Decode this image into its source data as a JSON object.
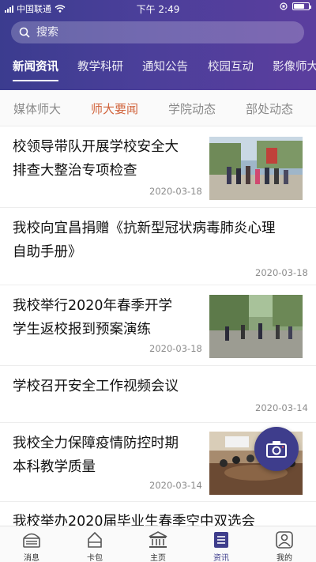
{
  "status_bar": {
    "carrier": "中国联通",
    "time": "下午 2:49",
    "battery_level": 0.72
  },
  "search": {
    "placeholder": "搜索"
  },
  "top_tabs": [
    {
      "label": "新闻资讯",
      "active": true
    },
    {
      "label": "教学科研",
      "active": false
    },
    {
      "label": "通知公告",
      "active": false
    },
    {
      "label": "校园互动",
      "active": false
    },
    {
      "label": "影像师大",
      "active": false
    }
  ],
  "sub_tabs": [
    {
      "label": "媒体师大",
      "active": false
    },
    {
      "label": "师大要闻",
      "active": true
    },
    {
      "label": "学院动态",
      "active": false
    },
    {
      "label": "部处动态",
      "active": false
    }
  ],
  "news": [
    {
      "title_lines": [
        "校领导带队开展学校安全大",
        "排查大整治专项检查"
      ],
      "date": "2020-03-18",
      "has_image": true
    },
    {
      "title_lines": [
        "我校向宜昌捐赠《抗新型冠状病毒肺炎心理",
        "自助手册》"
      ],
      "date": "2020-03-18",
      "has_image": false
    },
    {
      "title_lines": [
        "我校举行2020年春季开学",
        "学生返校报到预案演练"
      ],
      "date": "2020-03-18",
      "has_image": true
    },
    {
      "title_lines": [
        "学校召开安全工作视频会议"
      ],
      "date": "2020-03-14",
      "has_image": false
    },
    {
      "title_lines": [
        "我校全力保障疫情防控时期",
        "本科教学质量"
      ],
      "date": "2020-03-14",
      "has_image": true
    },
    {
      "title_lines": [
        "我校举办2020届毕业生春季空中双选会"
      ],
      "date": "",
      "has_image": false
    }
  ],
  "bottom_nav": [
    {
      "label": "消息",
      "icon": "message-icon",
      "active": false
    },
    {
      "label": "卡包",
      "icon": "card-wallet-icon",
      "active": false
    },
    {
      "label": "主页",
      "icon": "home-building-icon",
      "active": false
    },
    {
      "label": "资讯",
      "icon": "news-icon",
      "active": true
    },
    {
      "label": "我的",
      "icon": "profile-icon",
      "active": false
    }
  ],
  "colors": {
    "header_start": "#3b3c8f",
    "header_end": "#5b3e9e",
    "accent_subtab": "#d0623a",
    "nav_active": "#3e3d8c"
  }
}
